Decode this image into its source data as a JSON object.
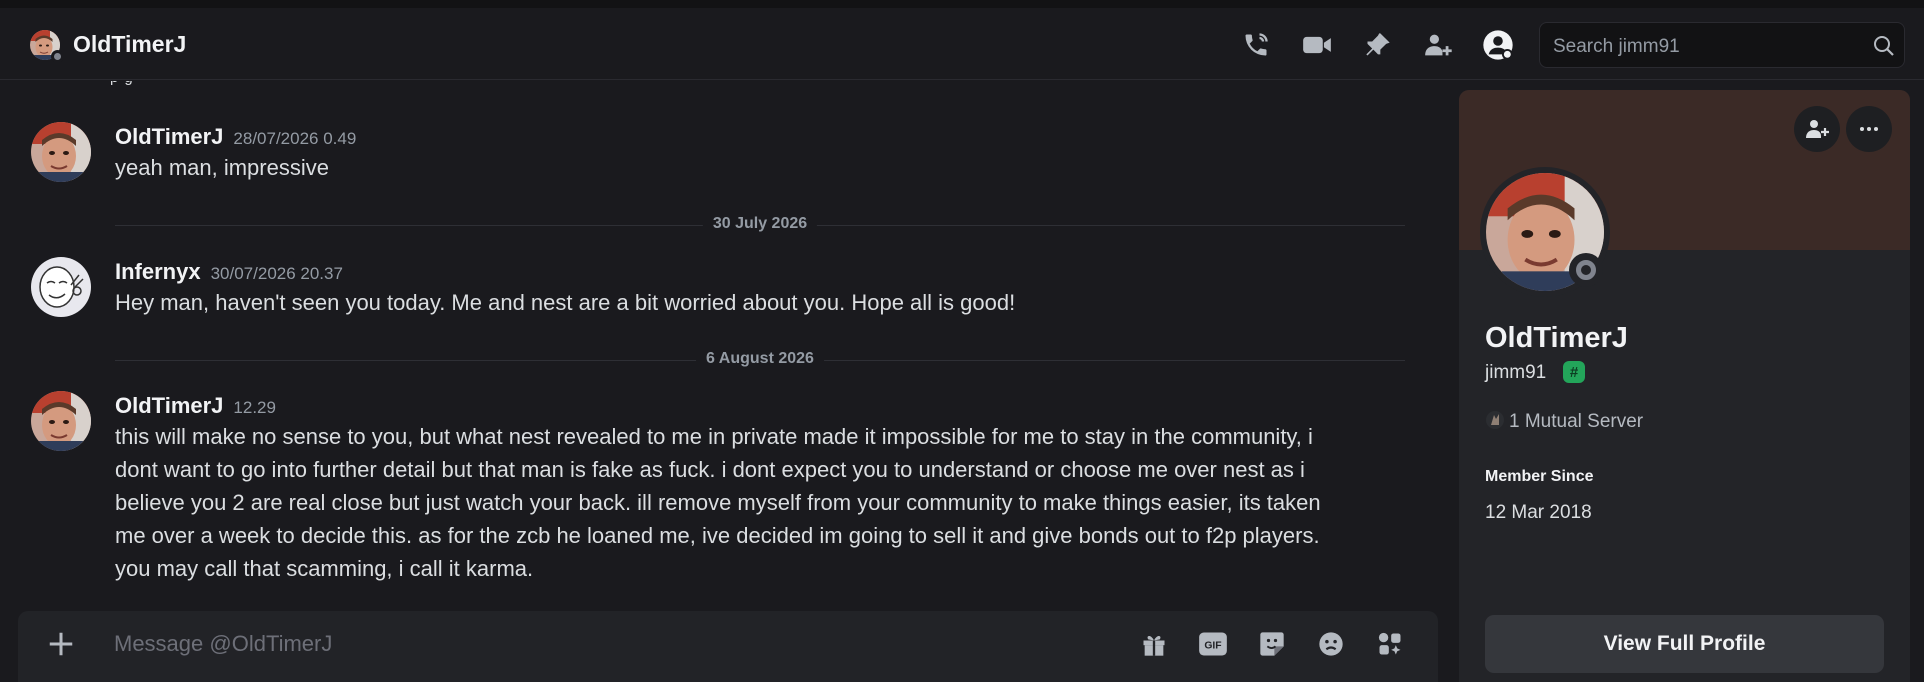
{
  "header": {
    "username": "OldTimerJ",
    "search_placeholder": "Search jimm91",
    "icons": [
      "phone-call-icon",
      "video-camera-icon",
      "pin-icon",
      "add-friends-to-dm-icon",
      "user-profile-icon",
      "search-icon"
    ]
  },
  "messages": {
    "clipped_text": "ᵖ ᵍ",
    "m1": {
      "author": "OldTimerJ",
      "time": "28/07/2026 0.49",
      "text": "yeah man, impressive"
    },
    "divider1": "30 July 2026",
    "m2": {
      "author": "Infernyx",
      "time": "30/07/2026 20.37",
      "text": "Hey man, haven't seen you today. Me and nest are a bit worried about you. Hope all is good!"
    },
    "divider2": "6 August 2026",
    "m3": {
      "author": "OldTimerJ",
      "time": "12.29",
      "lines": [
        "this will make no sense to you, but what nest revealed to me in private made it impossible for me to stay in the community, i",
        "dont want to go into further detail but that man is fake as fuck. i dont expect you to understand or choose me over nest as i",
        "believe you 2 are real close but just watch your back. ill remove myself from your community to make things easier, its taken",
        "me over a week to decide this. as for the zcb he loaned me, ive decided im going to sell it and give bonds out to f2p players.",
        "you may call that scamming, i call it karma."
      ]
    }
  },
  "composer": {
    "placeholder": "Message @OldTimerJ",
    "icons": [
      "plus-icon",
      "gift-icon",
      "gif-icon",
      "sticker-icon",
      "emoji-icon",
      "apps-icon"
    ],
    "gif_label": "GIF"
  },
  "profile": {
    "display_name": "OldTimerJ",
    "username": "jimm91",
    "badge": "#",
    "mutual": "1 Mutual Server",
    "member_since_label": "Member Since",
    "member_since": "12 Mar 2018",
    "view_button": "View Full Profile"
  },
  "colors": {
    "background": "#1a1a1e",
    "panel": "#232428",
    "banner": "#3b2a26",
    "badge_green": "#23a55a",
    "status_offline": "#80848e"
  }
}
